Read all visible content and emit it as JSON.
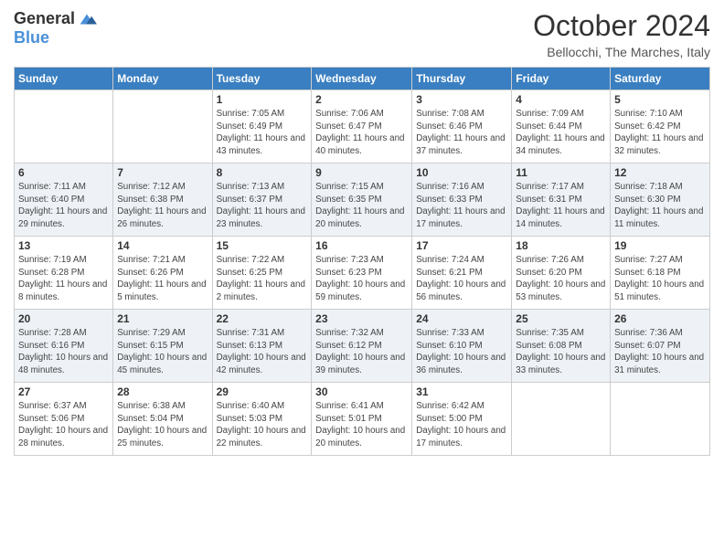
{
  "logo": {
    "line1": "General",
    "line2": "Blue"
  },
  "header": {
    "month": "October 2024",
    "location": "Bellocchi, The Marches, Italy"
  },
  "weekdays": [
    "Sunday",
    "Monday",
    "Tuesday",
    "Wednesday",
    "Thursday",
    "Friday",
    "Saturday"
  ],
  "weeks": [
    [
      {
        "day": "",
        "sunrise": "",
        "sunset": "",
        "daylight": ""
      },
      {
        "day": "",
        "sunrise": "",
        "sunset": "",
        "daylight": ""
      },
      {
        "day": "1",
        "sunrise": "Sunrise: 7:05 AM",
        "sunset": "Sunset: 6:49 PM",
        "daylight": "Daylight: 11 hours and 43 minutes."
      },
      {
        "day": "2",
        "sunrise": "Sunrise: 7:06 AM",
        "sunset": "Sunset: 6:47 PM",
        "daylight": "Daylight: 11 hours and 40 minutes."
      },
      {
        "day": "3",
        "sunrise": "Sunrise: 7:08 AM",
        "sunset": "Sunset: 6:46 PM",
        "daylight": "Daylight: 11 hours and 37 minutes."
      },
      {
        "day": "4",
        "sunrise": "Sunrise: 7:09 AM",
        "sunset": "Sunset: 6:44 PM",
        "daylight": "Daylight: 11 hours and 34 minutes."
      },
      {
        "day": "5",
        "sunrise": "Sunrise: 7:10 AM",
        "sunset": "Sunset: 6:42 PM",
        "daylight": "Daylight: 11 hours and 32 minutes."
      }
    ],
    [
      {
        "day": "6",
        "sunrise": "Sunrise: 7:11 AM",
        "sunset": "Sunset: 6:40 PM",
        "daylight": "Daylight: 11 hours and 29 minutes."
      },
      {
        "day": "7",
        "sunrise": "Sunrise: 7:12 AM",
        "sunset": "Sunset: 6:38 PM",
        "daylight": "Daylight: 11 hours and 26 minutes."
      },
      {
        "day": "8",
        "sunrise": "Sunrise: 7:13 AM",
        "sunset": "Sunset: 6:37 PM",
        "daylight": "Daylight: 11 hours and 23 minutes."
      },
      {
        "day": "9",
        "sunrise": "Sunrise: 7:15 AM",
        "sunset": "Sunset: 6:35 PM",
        "daylight": "Daylight: 11 hours and 20 minutes."
      },
      {
        "day": "10",
        "sunrise": "Sunrise: 7:16 AM",
        "sunset": "Sunset: 6:33 PM",
        "daylight": "Daylight: 11 hours and 17 minutes."
      },
      {
        "day": "11",
        "sunrise": "Sunrise: 7:17 AM",
        "sunset": "Sunset: 6:31 PM",
        "daylight": "Daylight: 11 hours and 14 minutes."
      },
      {
        "day": "12",
        "sunrise": "Sunrise: 7:18 AM",
        "sunset": "Sunset: 6:30 PM",
        "daylight": "Daylight: 11 hours and 11 minutes."
      }
    ],
    [
      {
        "day": "13",
        "sunrise": "Sunrise: 7:19 AM",
        "sunset": "Sunset: 6:28 PM",
        "daylight": "Daylight: 11 hours and 8 minutes."
      },
      {
        "day": "14",
        "sunrise": "Sunrise: 7:21 AM",
        "sunset": "Sunset: 6:26 PM",
        "daylight": "Daylight: 11 hours and 5 minutes."
      },
      {
        "day": "15",
        "sunrise": "Sunrise: 7:22 AM",
        "sunset": "Sunset: 6:25 PM",
        "daylight": "Daylight: 11 hours and 2 minutes."
      },
      {
        "day": "16",
        "sunrise": "Sunrise: 7:23 AM",
        "sunset": "Sunset: 6:23 PM",
        "daylight": "Daylight: 10 hours and 59 minutes."
      },
      {
        "day": "17",
        "sunrise": "Sunrise: 7:24 AM",
        "sunset": "Sunset: 6:21 PM",
        "daylight": "Daylight: 10 hours and 56 minutes."
      },
      {
        "day": "18",
        "sunrise": "Sunrise: 7:26 AM",
        "sunset": "Sunset: 6:20 PM",
        "daylight": "Daylight: 10 hours and 53 minutes."
      },
      {
        "day": "19",
        "sunrise": "Sunrise: 7:27 AM",
        "sunset": "Sunset: 6:18 PM",
        "daylight": "Daylight: 10 hours and 51 minutes."
      }
    ],
    [
      {
        "day": "20",
        "sunrise": "Sunrise: 7:28 AM",
        "sunset": "Sunset: 6:16 PM",
        "daylight": "Daylight: 10 hours and 48 minutes."
      },
      {
        "day": "21",
        "sunrise": "Sunrise: 7:29 AM",
        "sunset": "Sunset: 6:15 PM",
        "daylight": "Daylight: 10 hours and 45 minutes."
      },
      {
        "day": "22",
        "sunrise": "Sunrise: 7:31 AM",
        "sunset": "Sunset: 6:13 PM",
        "daylight": "Daylight: 10 hours and 42 minutes."
      },
      {
        "day": "23",
        "sunrise": "Sunrise: 7:32 AM",
        "sunset": "Sunset: 6:12 PM",
        "daylight": "Daylight: 10 hours and 39 minutes."
      },
      {
        "day": "24",
        "sunrise": "Sunrise: 7:33 AM",
        "sunset": "Sunset: 6:10 PM",
        "daylight": "Daylight: 10 hours and 36 minutes."
      },
      {
        "day": "25",
        "sunrise": "Sunrise: 7:35 AM",
        "sunset": "Sunset: 6:08 PM",
        "daylight": "Daylight: 10 hours and 33 minutes."
      },
      {
        "day": "26",
        "sunrise": "Sunrise: 7:36 AM",
        "sunset": "Sunset: 6:07 PM",
        "daylight": "Daylight: 10 hours and 31 minutes."
      }
    ],
    [
      {
        "day": "27",
        "sunrise": "Sunrise: 6:37 AM",
        "sunset": "Sunset: 5:06 PM",
        "daylight": "Daylight: 10 hours and 28 minutes."
      },
      {
        "day": "28",
        "sunrise": "Sunrise: 6:38 AM",
        "sunset": "Sunset: 5:04 PM",
        "daylight": "Daylight: 10 hours and 25 minutes."
      },
      {
        "day": "29",
        "sunrise": "Sunrise: 6:40 AM",
        "sunset": "Sunset: 5:03 PM",
        "daylight": "Daylight: 10 hours and 22 minutes."
      },
      {
        "day": "30",
        "sunrise": "Sunrise: 6:41 AM",
        "sunset": "Sunset: 5:01 PM",
        "daylight": "Daylight: 10 hours and 20 minutes."
      },
      {
        "day": "31",
        "sunrise": "Sunrise: 6:42 AM",
        "sunset": "Sunset: 5:00 PM",
        "daylight": "Daylight: 10 hours and 17 minutes."
      },
      {
        "day": "",
        "sunrise": "",
        "sunset": "",
        "daylight": ""
      },
      {
        "day": "",
        "sunrise": "",
        "sunset": "",
        "daylight": ""
      }
    ]
  ]
}
